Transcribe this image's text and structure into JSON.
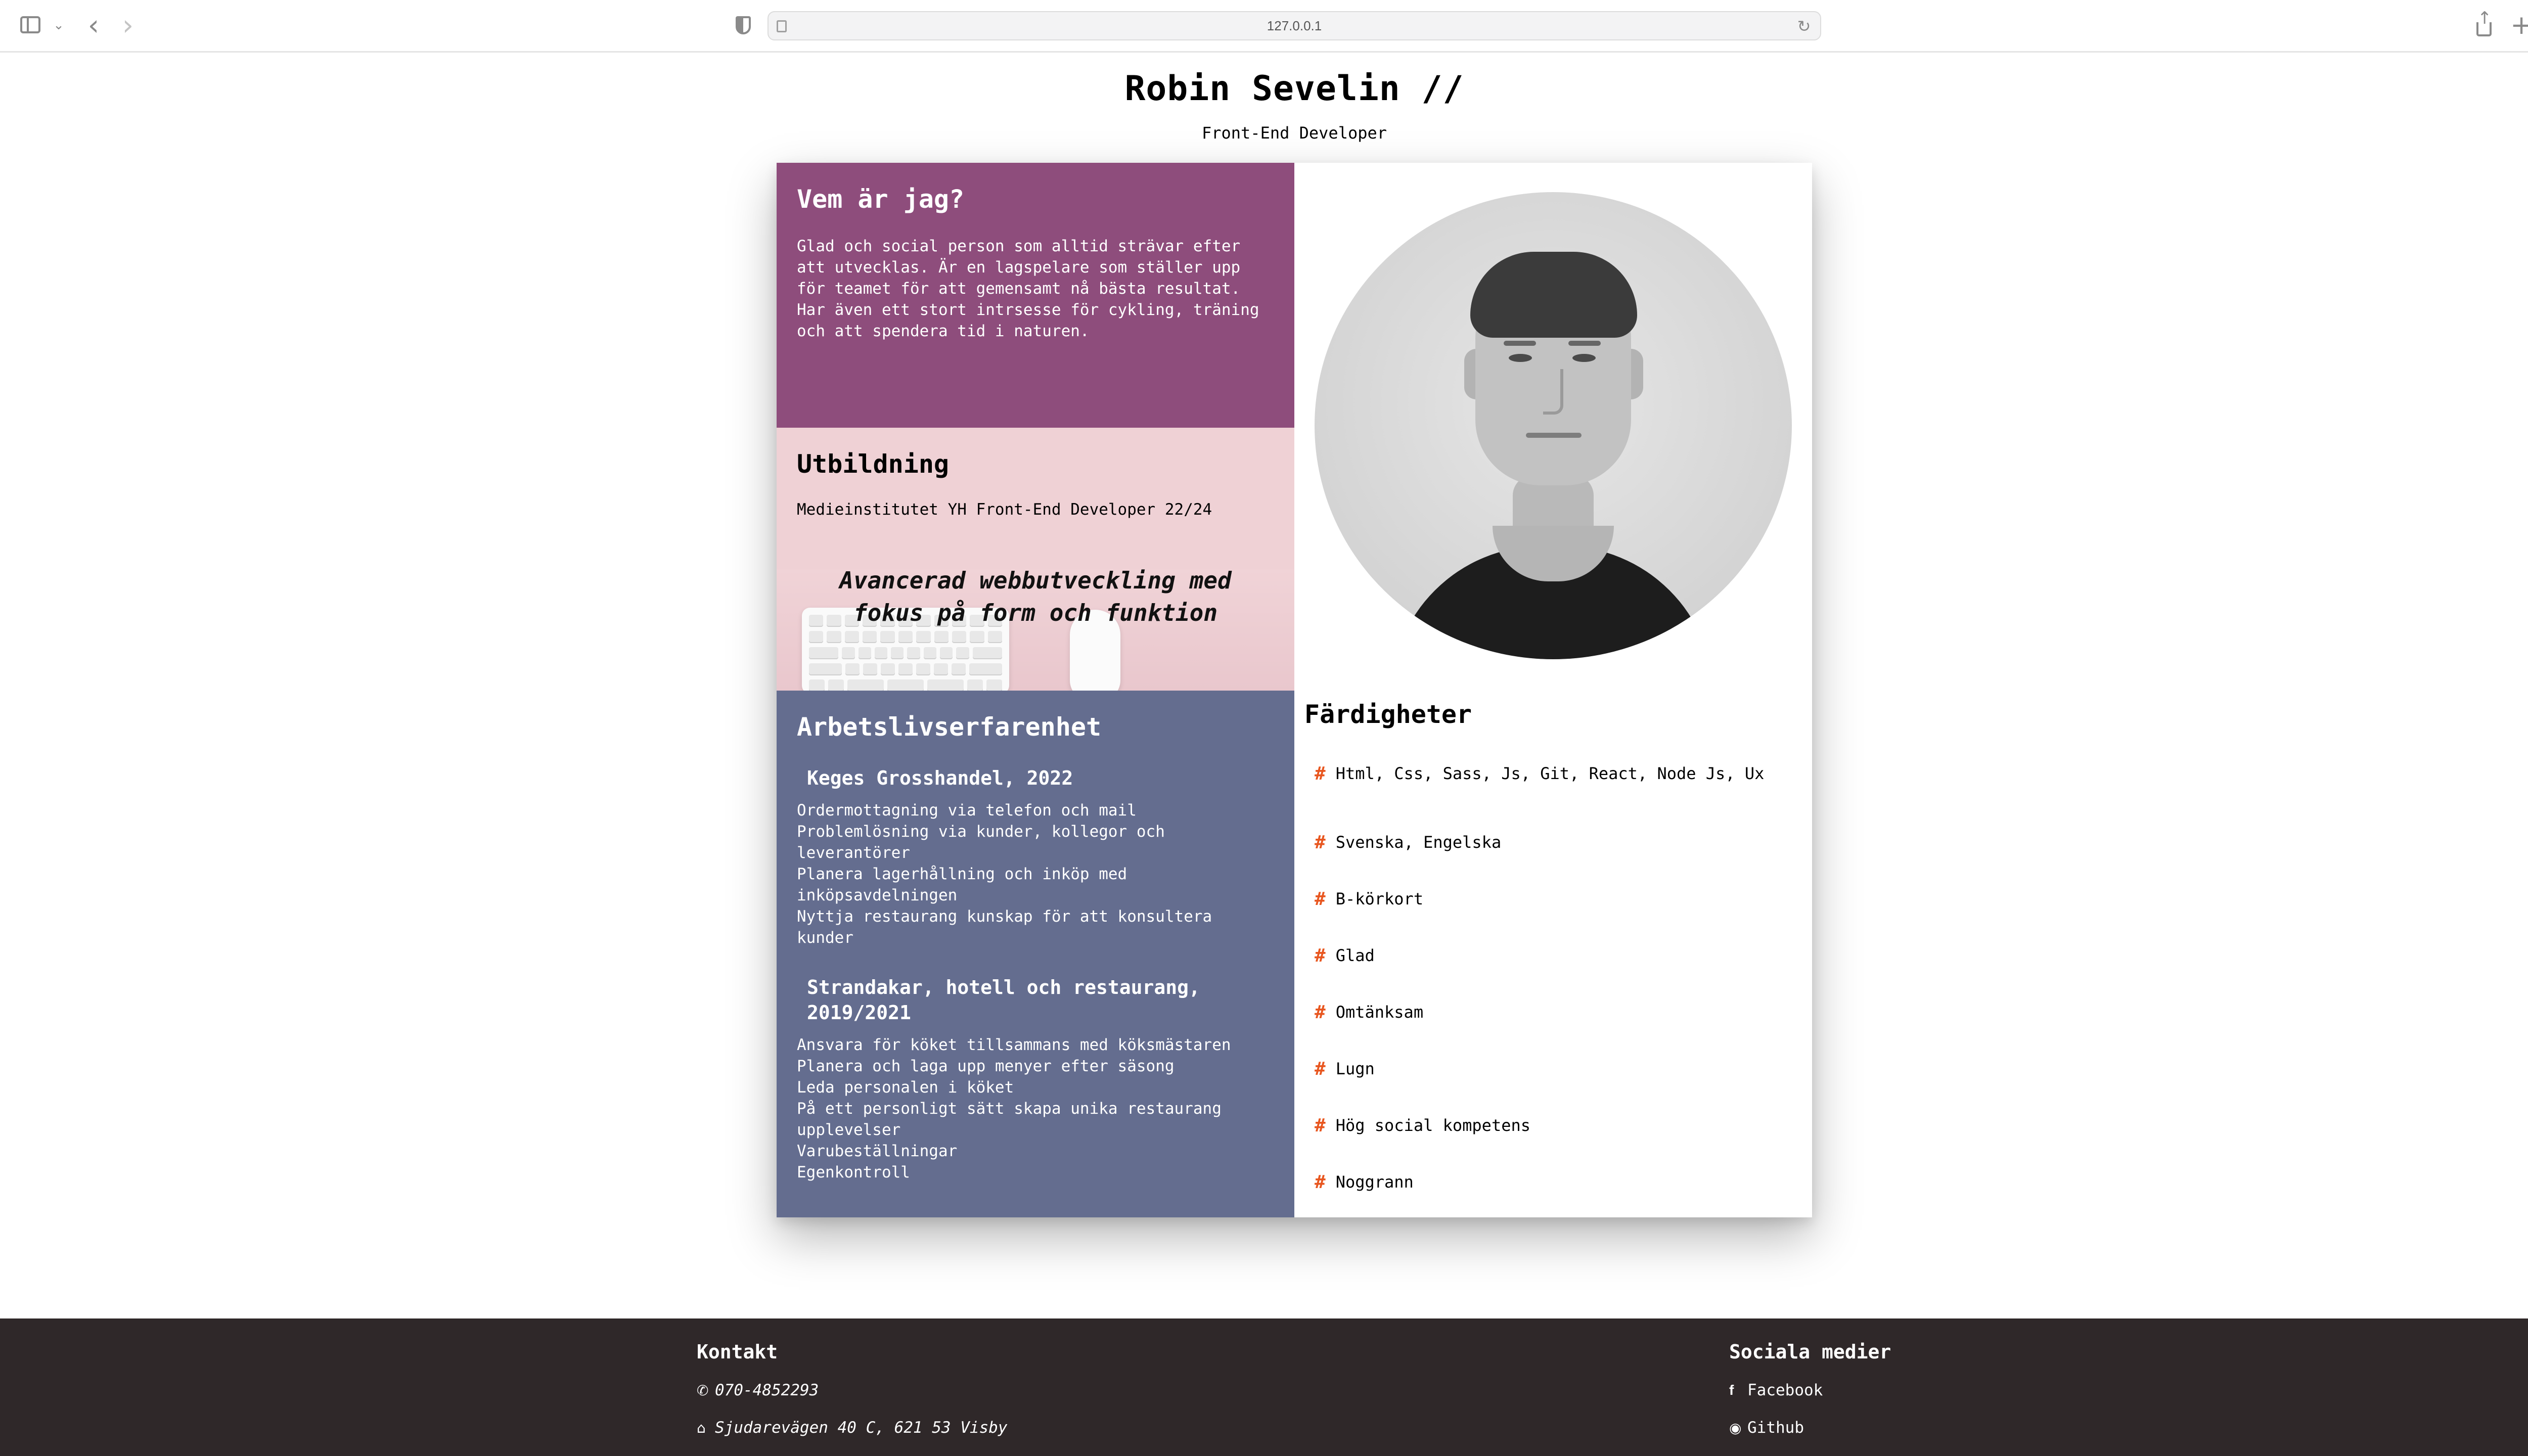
{
  "browser": {
    "url": "127.0.0.1"
  },
  "header": {
    "name": "Robin Sevelin //",
    "role": "Front-End Developer"
  },
  "about": {
    "title": "Vem är jag?",
    "text": "Glad och social person som alltid strävar efter att utvecklas. Är en lagspelare som ställer upp för teamet för att gemensamt nå bästa resultat. Har även ett stort intrsesse för cykling, träning och att spendera tid i naturen."
  },
  "education": {
    "title": "Utbildning",
    "line": "Medieinstitutet YH Front-End Developer 22/24",
    "tagline": "Avancerad webbutveckling med fokus på form och funktion"
  },
  "work": {
    "title": "Arbetslivserfarenhet",
    "jobs": [
      {
        "title": "Keges Grosshandel, 2022",
        "duties": [
          "Ordermottagning via telefon och mail",
          "Problemlösning via kunder, kollegor och leverantörer",
          "Planera lagerhållning och inköp med inköpsavdelningen",
          "Nyttja restaurang kunskap för att konsultera kunder"
        ]
      },
      {
        "title": "Strandakar, hotell och restaurang, 2019/2021",
        "duties": [
          "Ansvara för köket tillsammans med köksmästaren",
          "Planera och laga upp menyer efter säsong",
          "Leda personalen i köket",
          "På ett personligt sätt skapa unika restaurang upplevelser",
          "Varubeställningar",
          "Egenkontroll"
        ]
      }
    ]
  },
  "skills": {
    "title": "Färdigheter",
    "bullet": "#",
    "items": [
      "Html, Css, Sass, Js, Git, React, Node Js, Ux",
      "Svenska, Engelska",
      "B-körkort",
      "Glad",
      "Omtänksam",
      "Lugn",
      "Hög social kompetens",
      "Noggrann"
    ]
  },
  "footer": {
    "contact_title": "Kontakt",
    "phone": "070-4852293",
    "address": "Sjudarevägen 40 C, 621 53 Visby",
    "social_title": "Sociala medier",
    "facebook": "Facebook",
    "github": "Github"
  },
  "colors": {
    "about_bg": "#8e4d7c",
    "education_bg": "#efd1d5",
    "work_bg": "#646d8f",
    "skill_bullet": "#e8561f",
    "footer_bg": "#2f2829"
  },
  "icons": {
    "phone": "phone-icon",
    "address": "home-icon",
    "facebook": "facebook-icon",
    "github": "github-icon"
  }
}
